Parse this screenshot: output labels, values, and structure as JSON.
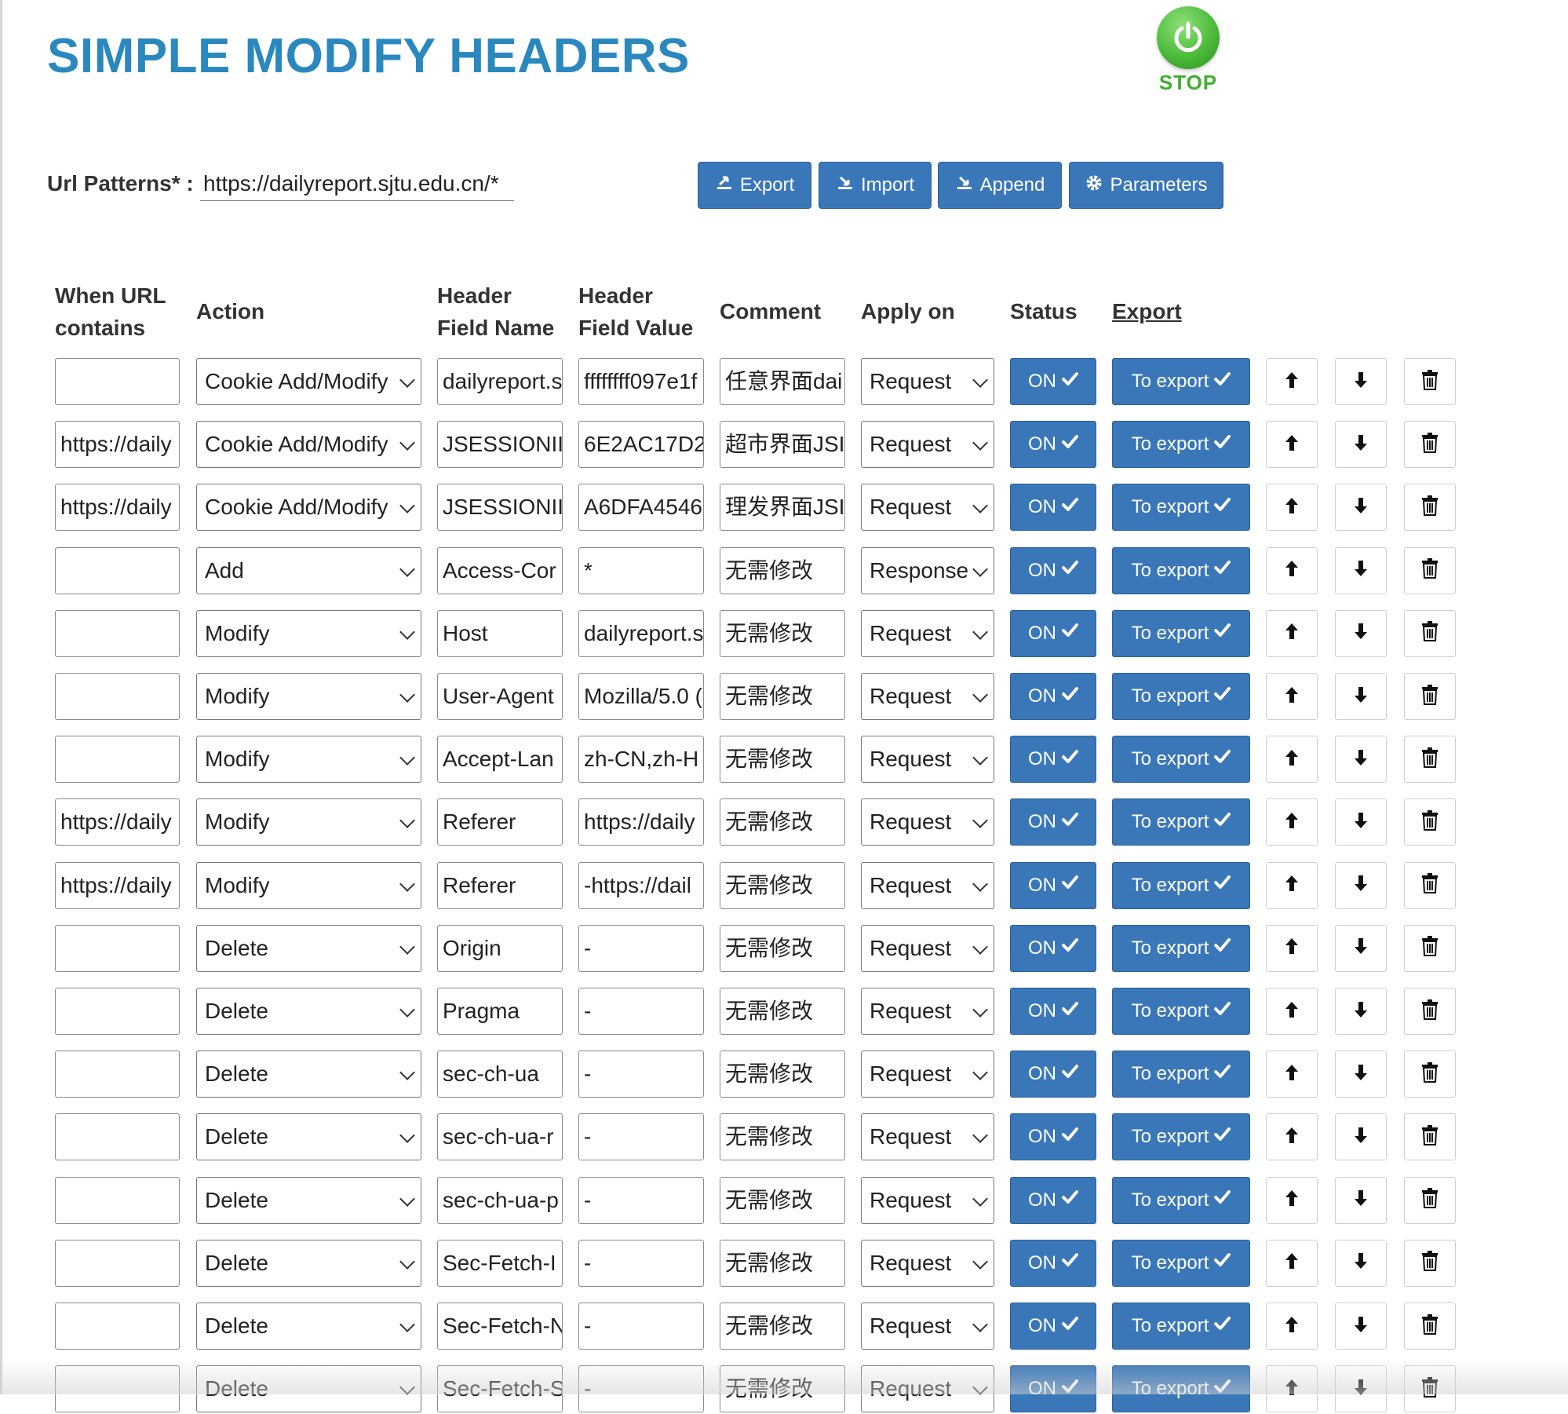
{
  "app": {
    "title": "SIMPLE MODIFY HEADERS",
    "stop_label": "STOP",
    "accent_color": "#3a77b9",
    "title_color": "#2a88be",
    "stop_color": "#4cbb3a"
  },
  "url": {
    "label": "Url Patterns* :",
    "value": "https://dailyreport.sjtu.edu.cn/*"
  },
  "toolbar": {
    "export_label": "Export",
    "import_label": "Import",
    "append_label": "Append",
    "parameters_label": "Parameters"
  },
  "columns": {
    "when_url_1": "When URL",
    "when_url_2": "contains",
    "action": "Action",
    "field_name_1": "Header",
    "field_name_2": "Field Name",
    "field_value_1": "Header",
    "field_value_2": "Field Value",
    "comment": "Comment",
    "apply_on": "Apply on",
    "status": "Status",
    "export": "Export"
  },
  "row_labels": {
    "status": "ON",
    "export": "To export"
  },
  "rows": [
    {
      "url": "",
      "action": "Cookie Add/Modify",
      "name": "dailyreport.s",
      "value": "ffffffff097e1f",
      "comment": "任意界面dai",
      "apply": "Request"
    },
    {
      "url": "https://daily",
      "action": "Cookie Add/Modify",
      "name": "JSESSIONII",
      "value": "6E2AC17D2",
      "comment": "超市界面JSI",
      "apply": "Request"
    },
    {
      "url": "https://daily",
      "action": "Cookie Add/Modify",
      "name": "JSESSIONII",
      "value": "A6DFA4546",
      "comment": "理发界面JSI",
      "apply": "Request"
    },
    {
      "url": "",
      "action": "Add",
      "name": "Access-Cor",
      "value": "*",
      "comment": "无需修改",
      "apply": "Response"
    },
    {
      "url": "",
      "action": "Modify",
      "name": "Host",
      "value": "dailyreport.s",
      "comment": "无需修改",
      "apply": "Request"
    },
    {
      "url": "",
      "action": "Modify",
      "name": "User-Agent",
      "value": "Mozilla/5.0 (",
      "comment": "无需修改",
      "apply": "Request"
    },
    {
      "url": "",
      "action": "Modify",
      "name": "Accept-Lan",
      "value": "zh-CN,zh-H",
      "comment": "无需修改",
      "apply": "Request"
    },
    {
      "url": "https://daily",
      "action": "Modify",
      "name": "Referer",
      "value": "https://daily",
      "comment": "无需修改",
      "apply": "Request"
    },
    {
      "url": "https://daily",
      "action": "Modify",
      "name": "Referer",
      "value": "-https://dail",
      "comment": "无需修改",
      "apply": "Request"
    },
    {
      "url": "",
      "action": "Delete",
      "name": "Origin",
      "value": "-",
      "comment": "无需修改",
      "apply": "Request"
    },
    {
      "url": "",
      "action": "Delete",
      "name": "Pragma",
      "value": "-",
      "comment": "无需修改",
      "apply": "Request"
    },
    {
      "url": "",
      "action": "Delete",
      "name": "sec-ch-ua",
      "value": "-",
      "comment": "无需修改",
      "apply": "Request"
    },
    {
      "url": "",
      "action": "Delete",
      "name": "sec-ch-ua-r",
      "value": "-",
      "comment": "无需修改",
      "apply": "Request"
    },
    {
      "url": "",
      "action": "Delete",
      "name": "sec-ch-ua-p",
      "value": "-",
      "comment": "无需修改",
      "apply": "Request"
    },
    {
      "url": "",
      "action": "Delete",
      "name": "Sec-Fetch-I",
      "value": "-",
      "comment": "无需修改",
      "apply": "Request"
    },
    {
      "url": "",
      "action": "Delete",
      "name": "Sec-Fetch-N",
      "value": "-",
      "comment": "无需修改",
      "apply": "Request"
    },
    {
      "url": "",
      "action": "Delete",
      "name": "Sec-Fetch-S",
      "value": "-",
      "comment": "无需修改",
      "apply": "Request"
    }
  ]
}
